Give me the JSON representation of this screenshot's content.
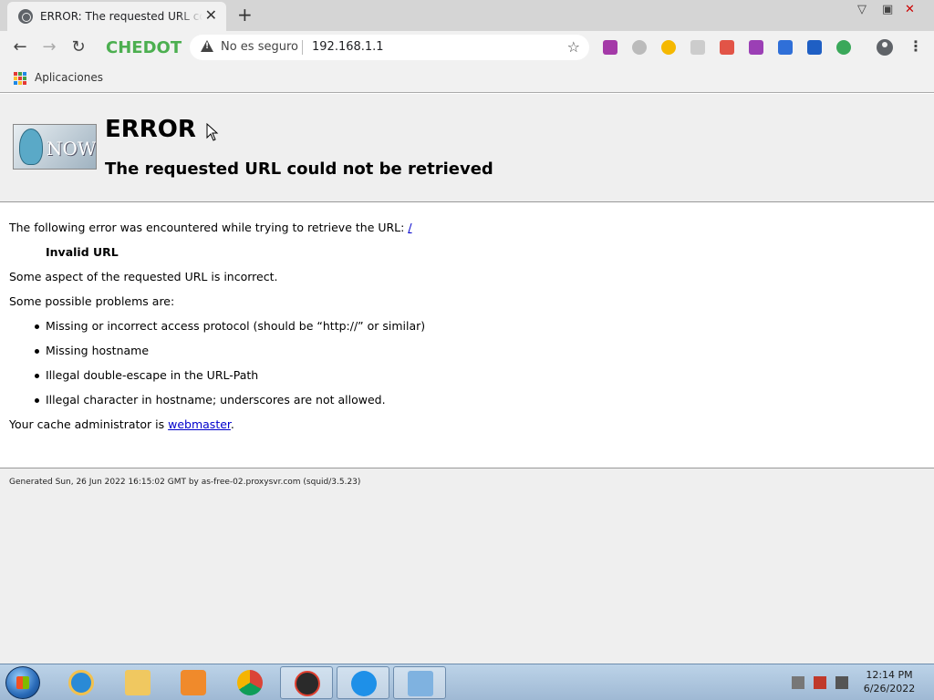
{
  "browser": {
    "tab_title": "ERROR: The requested URL could not be retrieved",
    "brand": "CHEDOT",
    "security_label": "No es seguro",
    "url": "192.168.1.1",
    "bookmarks_apps_label": "Aplicaciones",
    "extensions": [
      "media-ext-icon",
      "whatsapp-icon",
      "messenger-icon",
      "lock-ext-icon",
      "video-ext-icon",
      "download-icon",
      "facebook-icon",
      "star-ext-icon",
      "gear-ext-icon"
    ]
  },
  "error_page": {
    "title": "ERROR",
    "subtitle": "The requested URL could not be retrieved",
    "logo_text": "NOW",
    "intro": "The following error was encountered while trying to retrieve the URL: ",
    "intro_link": "/",
    "error_name": "Invalid URL",
    "description": "Some aspect of the requested URL is incorrect.",
    "problems_heading": "Some possible problems are:",
    "problems": [
      "Missing or incorrect access protocol (should be “http://” or similar)",
      "Missing hostname",
      "Illegal double-escape in the URL-Path",
      "Illegal character in hostname; underscores are not allowed."
    ],
    "admin_prefix": "Your cache administrator is ",
    "admin_link": "webmaster",
    "admin_suffix": ".",
    "footer": "Generated Sun, 26 Jun 2022 16:15:02 GMT by as-free-02.proxysvr.com (squid/3.5.23)"
  },
  "taskbar": {
    "apps": [
      "internet-explorer-icon",
      "file-explorer-icon",
      "media-player-icon",
      "chrome-icon",
      "browser-app-icon",
      "q-app-icon",
      "control-panel-icon"
    ],
    "time": "12:14 PM",
    "date": "6/26/2022"
  }
}
